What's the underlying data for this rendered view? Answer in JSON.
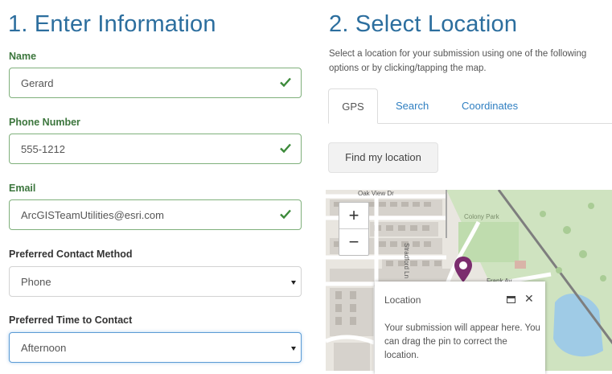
{
  "left": {
    "heading": "1. Enter Information",
    "name": {
      "label": "Name",
      "value": "Gerard"
    },
    "phone": {
      "label": "Phone Number",
      "value": "555-1212"
    },
    "email": {
      "label": "Email",
      "value": "ArcGISTeamUtilities@esri.com"
    },
    "contact_method": {
      "label": "Preferred Contact Method",
      "value": "Phone"
    },
    "contact_time": {
      "label": "Preferred Time to Contact",
      "value": "Afternoon"
    }
  },
  "right": {
    "heading": "2. Select Location",
    "description": "Select a location for your submission using one of the following options or by clicking/tapping the map.",
    "tabs": [
      {
        "label": "GPS",
        "active": true
      },
      {
        "label": "Search",
        "active": false
      },
      {
        "label": "Coordinates",
        "active": false
      }
    ],
    "find_button": "Find my location",
    "map": {
      "zoom_in": "+",
      "zoom_out": "−",
      "street_labels": [
        "Oak View Dr",
        "Stradford Ln",
        "Frank Av",
        "Colony Park"
      ],
      "popup": {
        "title": "Location",
        "body": "Your submission will appear here. You can drag the pin to correct the location.",
        "close": "✕"
      }
    }
  },
  "colors": {
    "heading": "#2c6e9e",
    "valid": "#3c763d",
    "link": "#2f7fc1",
    "pin": "#7b2d6e"
  }
}
